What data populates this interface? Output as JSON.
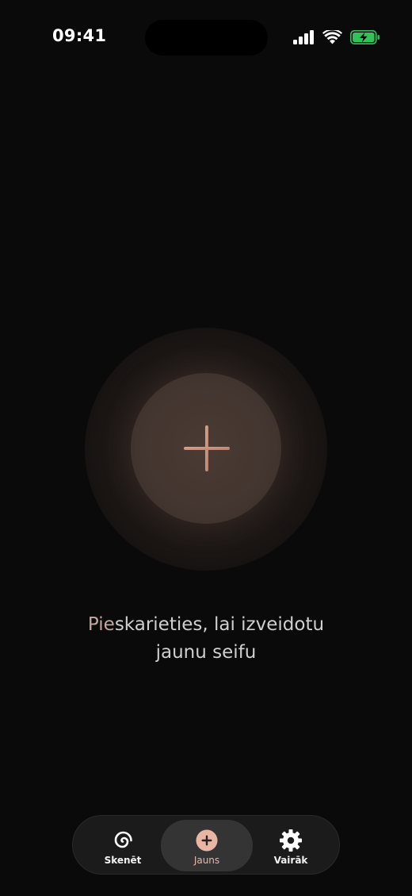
{
  "status_bar": {
    "time": "09:41"
  },
  "main": {
    "prompt_accent": "Pie",
    "prompt_rest_line1": "skarieties, lai izveidotu",
    "prompt_line2": "jaunu seifu",
    "plus_icon": "plus-icon",
    "accent_color": "#c4a79c"
  },
  "tab_bar": {
    "tabs": [
      {
        "label": "Skenēt",
        "icon": "spiral-icon",
        "active": false
      },
      {
        "label": "Jauns",
        "icon": "plus-circle-icon",
        "active": true
      },
      {
        "label": "Vairāk",
        "icon": "gear-icon",
        "active": false
      }
    ],
    "active_color": "#e9b6a6"
  }
}
